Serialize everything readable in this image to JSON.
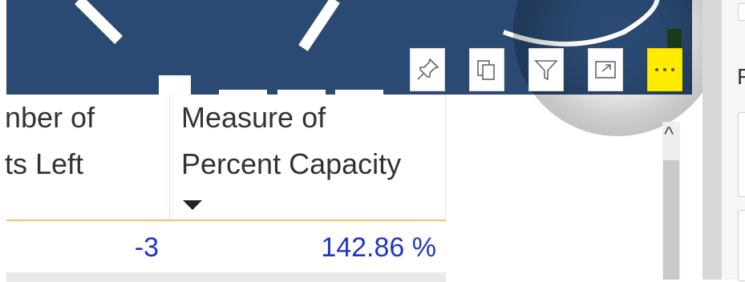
{
  "visual_header": {
    "buttons": [
      {
        "name": "pin-visual-button",
        "icon": "pin-icon"
      },
      {
        "name": "copy-visual-button",
        "icon": "copy-icon"
      },
      {
        "name": "filter-button",
        "icon": "filter-icon"
      },
      {
        "name": "focus-mode-button",
        "icon": "focus-mode-icon"
      },
      {
        "name": "more-options-button",
        "icon": "ellipsis-icon",
        "highlight": "#ffeb00"
      }
    ]
  },
  "table": {
    "columns": [
      {
        "label_line1": "nber of",
        "label_line2": "ts Left"
      },
      {
        "label_line1": "Measure of",
        "label_line2": "Percent Capacity"
      }
    ],
    "rows": [
      {
        "col1": "-3",
        "col2": "142.86 %"
      }
    ],
    "value_color": "#1f36c8",
    "header_rule_color": "#f2c46a"
  },
  "scrollbar": {
    "up_glyph": "^"
  },
  "right_pane": {
    "label": "F"
  },
  "colors": {
    "banner": "#2b4a73"
  }
}
